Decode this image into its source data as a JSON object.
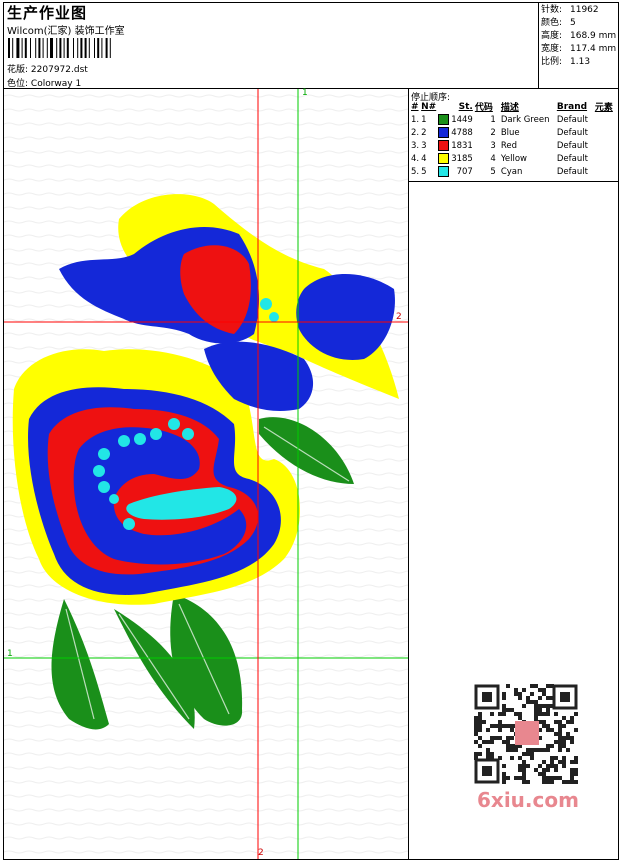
{
  "header": {
    "title": "生产作业图",
    "company": "Wilcom(汇家) 装饰工作室",
    "design_label": "花版:",
    "design_value": "2207972.dst",
    "colorway_label": "色位:",
    "colorway_value": "Colorway 1"
  },
  "stats": [
    {
      "label": "针数:",
      "value": "11962"
    },
    {
      "label": "颜色:",
      "value": "5"
    },
    {
      "label": "高度:",
      "value": "168.9 mm"
    },
    {
      "label": "宽度:",
      "value": "117.4 mm"
    },
    {
      "label": "比例:",
      "value": "1.13"
    }
  ],
  "stop_sequence": {
    "title": "停止顺序:",
    "headers": [
      "#",
      "N#",
      "St.",
      "代码",
      "描述",
      "Brand",
      "元素"
    ],
    "rows": [
      {
        "num": "1.",
        "n": "1",
        "color": "#1a8f1a",
        "stitches": "1449",
        "code": "1",
        "desc": "Dark Green",
        "brand": "Default"
      },
      {
        "num": "2.",
        "n": "2",
        "color": "#1428d8",
        "stitches": "4788",
        "code": "2",
        "desc": "Blue",
        "brand": "Default"
      },
      {
        "num": "3.",
        "n": "3",
        "color": "#ee1111",
        "stitches": "1831",
        "code": "3",
        "desc": "Red",
        "brand": "Default"
      },
      {
        "num": "4.",
        "n": "4",
        "color": "#ffff00",
        "stitches": "3185",
        "code": "4",
        "desc": "Yellow",
        "brand": "Default"
      },
      {
        "num": "5.",
        "n": "5",
        "color": "#22e6e6",
        "stitches": "707",
        "code": "5",
        "desc": "Cyan",
        "brand": "Default"
      }
    ]
  },
  "guides": {
    "green_vertical_top": "1",
    "green_horizontal_left": "1",
    "red_horizontal_right": "2",
    "red_vertical_bottom": "2"
  },
  "watermark": "6xiu.com",
  "colors": {
    "green": "#1a8f1a",
    "blue": "#1428d8",
    "red": "#ee1111",
    "yellow": "#ffff00",
    "cyan": "#22e6e6"
  }
}
